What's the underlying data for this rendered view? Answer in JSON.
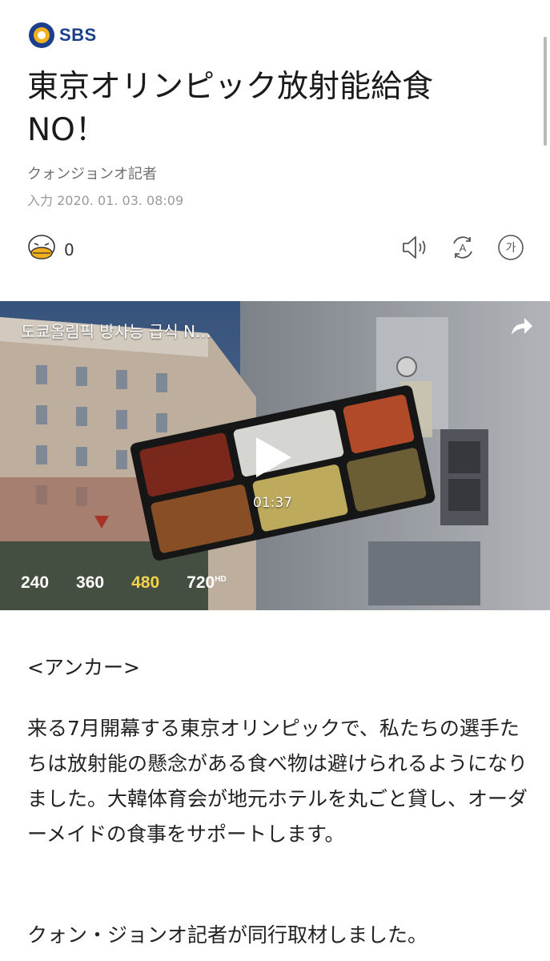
{
  "brand": {
    "name": "SBS",
    "colors": {
      "blue": "#1b3f8c",
      "yellow": "#f2b01e",
      "accent_quality": "#f2d44a"
    }
  },
  "article": {
    "title": "東京オリンピック放射能給食NO！",
    "reporter": "クォンジョンオ記者",
    "timestamp": "入力 2020. 01. 03. 08:09",
    "reaction_count": "0"
  },
  "toolbar": {
    "icons": [
      "speaker-icon",
      "translate-icon",
      "font-size-icon"
    ],
    "font_size_label": "가",
    "translate_label": "A"
  },
  "video": {
    "title": "도쿄올림픽 방사능 급식 N…",
    "duration": "01:37",
    "qualities": [
      "240",
      "360",
      "480",
      "720"
    ],
    "hd_badge": "HD",
    "selected_quality": "480"
  },
  "content": {
    "anchor": "<アンカー>",
    "paragraph1": "来る7月開幕する東京オリンピックで、私たちの選手たちは放射能の懸念がある食べ物は避けられるようになりました。大韓体育会が地元ホテルを丸ごと貸し、オーダーメイドの食事をサポートします。",
    "paragraph2": "クォン・ジョンオ記者が同行取材しました。"
  }
}
